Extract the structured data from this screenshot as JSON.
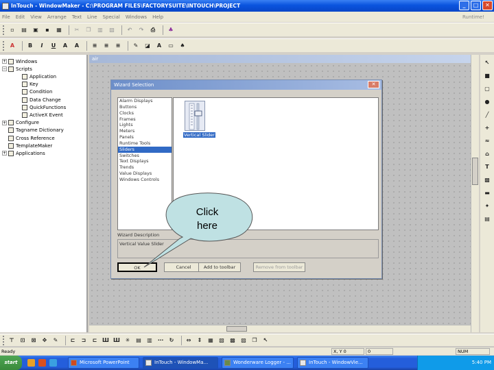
{
  "window": {
    "title": "InTouch - WindowMaker - C:\\PROGRAM FILES\\FACTORYSUITE\\INTOUCH\\PROJECT",
    "min": "_",
    "max": "□",
    "close": "✕"
  },
  "menu": {
    "items": [
      "File",
      "Edit",
      "View",
      "Arrange",
      "Text",
      "Line",
      "Special",
      "Windows",
      "Help"
    ],
    "runtime": "Runtime!"
  },
  "tree": [
    {
      "label": "Windows",
      "indent": 0,
      "exp": "+"
    },
    {
      "label": "Scripts",
      "indent": 0,
      "exp": "−"
    },
    {
      "label": "Application",
      "indent": 1,
      "exp": ""
    },
    {
      "label": "Key",
      "indent": 1,
      "exp": ""
    },
    {
      "label": "Condition",
      "indent": 1,
      "exp": ""
    },
    {
      "label": "Data Change",
      "indent": 1,
      "exp": ""
    },
    {
      "label": "QuickFunctions",
      "indent": 1,
      "exp": ""
    },
    {
      "label": "ActiveX Event",
      "indent": 1,
      "exp": ""
    },
    {
      "label": "Configure",
      "indent": 0,
      "exp": "+"
    },
    {
      "label": "Tagname Dictionary",
      "indent": 0,
      "exp": ""
    },
    {
      "label": "Cross Reference",
      "indent": 0,
      "exp": ""
    },
    {
      "label": "TemplateMaker",
      "indent": 0,
      "exp": ""
    },
    {
      "label": "Applications",
      "indent": 0,
      "exp": "+"
    }
  ],
  "canvas_window": {
    "title": "air"
  },
  "dialog": {
    "title": "Wizard Selection",
    "close": "✕",
    "categories": [
      "Alarm Displays",
      "Buttons",
      "Clocks",
      "Frames",
      "Lights",
      "Meters",
      "Panels",
      "Runtime Tools",
      "Sliders",
      "Switches",
      "Text Displays",
      "Trends",
      "Value Displays",
      "Windows Controls"
    ],
    "selected_index": 8,
    "wizard_label": "Vertical Slider",
    "description_label": "Wizard Description",
    "description": "Vertical Value Slider",
    "buttons": {
      "ok": "OK",
      "cancel": "Cancel",
      "add": "Add to toolbar",
      "remove": "Remove from toolbar"
    }
  },
  "callout": {
    "line1": "Click",
    "line2": "here"
  },
  "status": {
    "ready": "Ready",
    "xy": "X, Y  0",
    "y": "0",
    "num": "NUM"
  },
  "taskbar": {
    "start": "start",
    "tasks": [
      "Microsoft PowerPoint",
      "InTouch - WindowMa...",
      "Wonderware Logger - ...",
      "InTouch - WindowVie..."
    ],
    "active_index": 1,
    "clock": "5:40 PM"
  },
  "colors": {
    "title_blue": "#0a54de",
    "selection": "#316ac5",
    "callout_fill": "#bfe1e3"
  }
}
